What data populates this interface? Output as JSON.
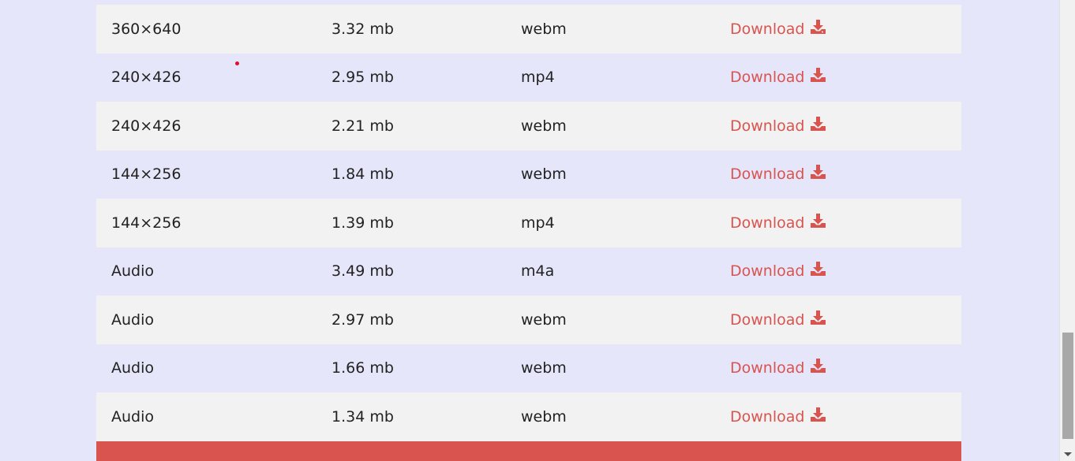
{
  "table": {
    "rows": [
      {
        "resolution": "360×640",
        "size": "3.32 mb",
        "format": "webm",
        "action": "Download"
      },
      {
        "resolution": "240×426",
        "size": "2.95 mb",
        "format": "mp4",
        "action": "Download"
      },
      {
        "resolution": "240×426",
        "size": "2.21 mb",
        "format": "webm",
        "action": "Download"
      },
      {
        "resolution": "144×256",
        "size": "1.84 mb",
        "format": "webm",
        "action": "Download"
      },
      {
        "resolution": "144×256",
        "size": "1.39 mb",
        "format": "mp4",
        "action": "Download"
      },
      {
        "resolution": "Audio",
        "size": "3.49 mb",
        "format": "m4a",
        "action": "Download"
      },
      {
        "resolution": "Audio",
        "size": "2.97 mb",
        "format": "webm",
        "action": "Download"
      },
      {
        "resolution": "Audio",
        "size": "1.66 mb",
        "format": "webm",
        "action": "Download"
      },
      {
        "resolution": "Audio",
        "size": "1.34 mb",
        "format": "webm",
        "action": "Download"
      }
    ]
  },
  "icons": {
    "download": "download-icon"
  },
  "colors": {
    "page_background": "#e6e6fa",
    "row_alt_background": "#f2f2f2",
    "accent": "#d9534f",
    "text": "#222222"
  }
}
